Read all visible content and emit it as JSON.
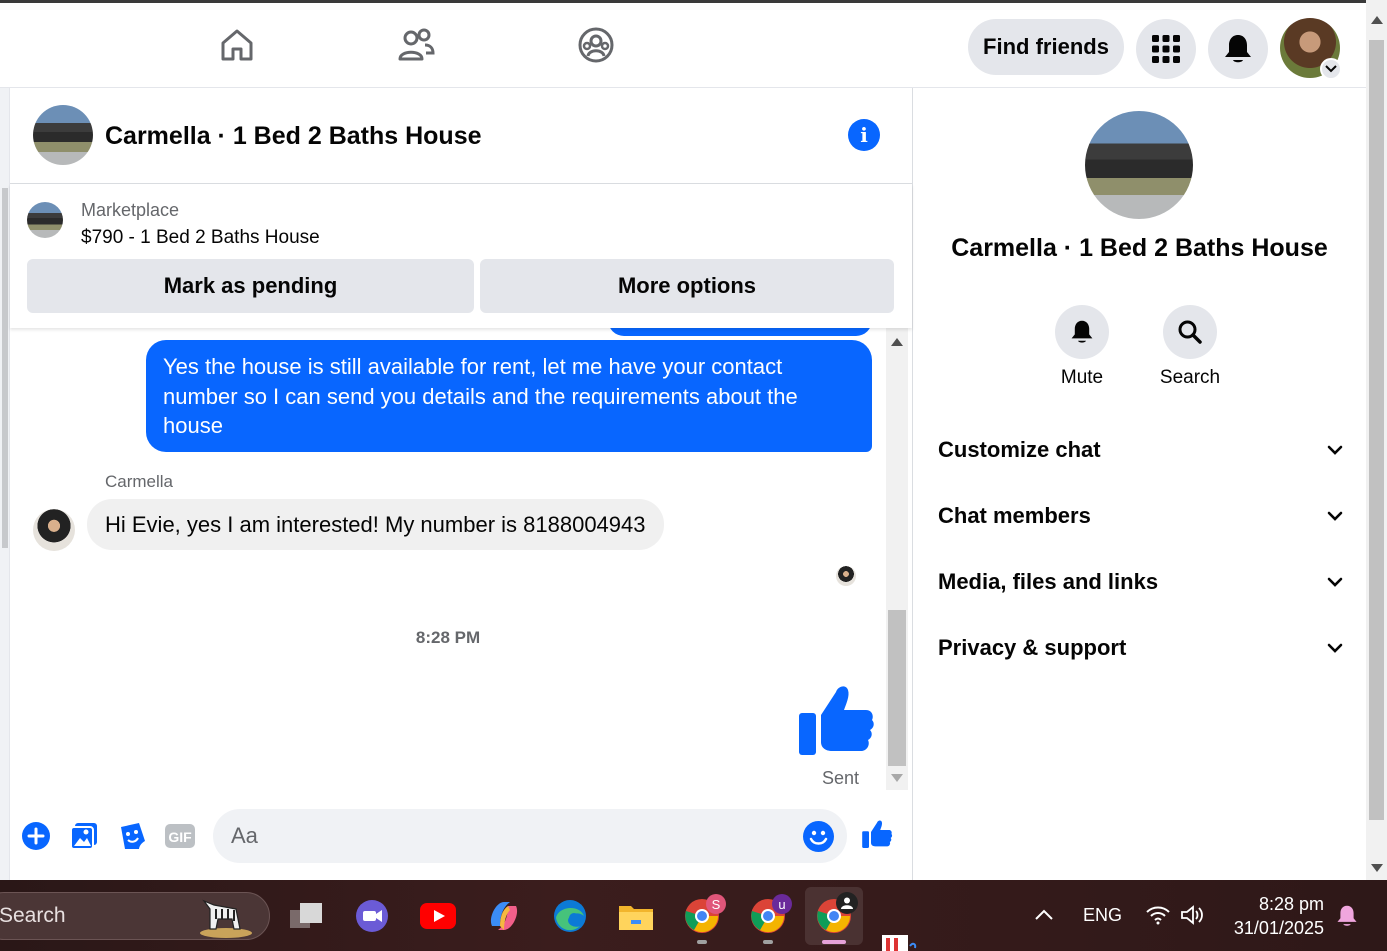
{
  "topnav": {
    "find_friends_label": "Find friends"
  },
  "chat": {
    "title": "Carmella · 1 Bed 2 Baths House",
    "marketplace": {
      "label": "Marketplace",
      "item": "$790 - 1 Bed 2 Baths House",
      "mark_pending_label": "Mark as pending",
      "more_options_label": "More options"
    },
    "messages": {
      "outgoing_text": "Yes the house is still available for rent, let me have your contact number so I can send you details and the requirements about the house",
      "sender_name": "Carmella",
      "incoming_text": "Hi Evie, yes I am interested! My number is 8188004943",
      "time_separator": "8:28 PM",
      "sent_status": "Sent"
    },
    "composer": {
      "placeholder": "Aa"
    }
  },
  "info_panel": {
    "name": "Carmella · 1 Bed 2 Baths House",
    "actions": [
      {
        "label": "Mute",
        "icon": "bell-icon"
      },
      {
        "label": "Search",
        "icon": "search-icon"
      }
    ],
    "sections": [
      {
        "label": "Customize chat"
      },
      {
        "label": "Chat members"
      },
      {
        "label": "Media, files and links"
      },
      {
        "label": "Privacy & support"
      }
    ]
  },
  "taskbar": {
    "search_label": "Search",
    "language": "ENG",
    "time": "8:28 pm",
    "date": "31/01/2025",
    "badges": {
      "chrome1": "S",
      "chrome2": "u"
    }
  },
  "colors": {
    "accent": "#0866ff",
    "bubble_incoming": "#f0f0f0",
    "button_gray": "#e4e6eb"
  }
}
